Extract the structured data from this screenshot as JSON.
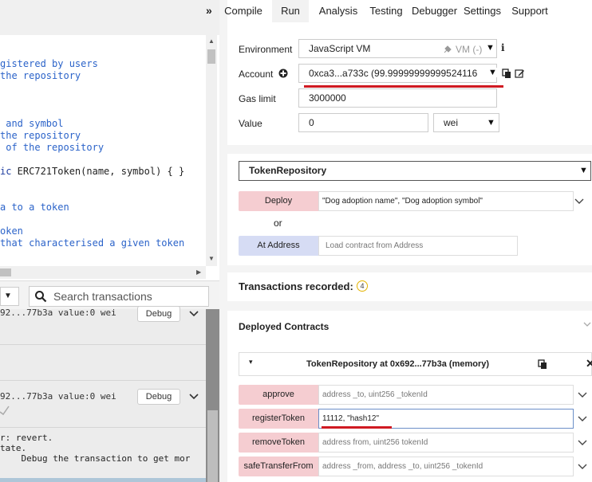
{
  "editor": {
    "lines": [
      {
        "pre": "",
        "text": "gistered by users",
        "cls": "cm"
      },
      {
        "pre": "",
        "text": "the repository",
        "cls": "cm"
      },
      {
        "pre": "",
        "text": "",
        "cls": ""
      },
      {
        "pre": "",
        "text": "",
        "cls": ""
      },
      {
        "pre": "",
        "text": "",
        "cls": ""
      },
      {
        "pre": "",
        "text": " and symbol",
        "cls": "cm"
      },
      {
        "pre": "",
        "text": "the repository",
        "cls": "cm"
      },
      {
        "pre": "",
        "text": " of the repository",
        "cls": "cm"
      },
      {
        "pre": "",
        "text": "",
        "cls": ""
      },
      {
        "pre": "ic",
        "text": " ERC721Token(name, symbol) { }",
        "cls": ""
      },
      {
        "pre": "",
        "text": "",
        "cls": ""
      },
      {
        "pre": "",
        "text": "",
        "cls": ""
      },
      {
        "pre": "",
        "text": "a to a token",
        "cls": "cm"
      },
      {
        "pre": "",
        "text": "",
        "cls": ""
      },
      {
        "pre": "",
        "text": "oken",
        "cls": "cm"
      },
      {
        "pre": "",
        "text": "that characterised a given token",
        "cls": "cm"
      }
    ]
  },
  "terminal": {
    "search_placeholder": "Search transactions",
    "tx1": {
      "text": "92...77b3a value:0 wei",
      "debug_label": "Debug"
    },
    "tx2": {
      "text": "92...77b3a value:0 wei",
      "debug_label": "Debug"
    },
    "error_lines": [
      "r: revert.",
      "tate.",
      "    Debug the transaction to get mor"
    ]
  },
  "tabs": {
    "items": [
      "Compile",
      "Run",
      "Analysis",
      "Testing",
      "Debugger",
      "Settings",
      "Support"
    ],
    "active": "Run"
  },
  "run": {
    "environment_label": "Environment",
    "environment_value": "JavaScript VM",
    "environment_badge": "VM (-)",
    "account_label": "Account",
    "account_value": "0xca3...a733c (99.99999999999524116",
    "gas_limit_label": "Gas limit",
    "gas_limit_value": "3000000",
    "value_label": "Value",
    "value_value": "0",
    "value_unit": "wei"
  },
  "deploy": {
    "contract": "TokenRepository",
    "deploy_label": "Deploy",
    "deploy_args": "\"Dog adoption name\", \"Dog adoption symbol\"",
    "or_label": "or",
    "at_address_label": "At Address",
    "at_address_placeholder": "Load contract from Address"
  },
  "transactions": {
    "label": "Transactions recorded:",
    "count": "4"
  },
  "deployed": {
    "title": "Deployed Contracts",
    "instance_title": "TokenRepository at 0x692...77b3a (memory)",
    "functions": [
      {
        "name": "approve",
        "placeholder": "address _to, uint256 _tokenId",
        "value": ""
      },
      {
        "name": "registerToken",
        "placeholder": "",
        "value": "11112, \"hash12\""
      },
      {
        "name": "removeToken",
        "placeholder": "address from, uint256 tokenId",
        "value": ""
      },
      {
        "name": "safeTransferFrom",
        "placeholder": "address _from, address _to, uint256 _tokenId",
        "value": ""
      }
    ]
  },
  "colors": {
    "accent_red": "#d01a22",
    "transact_fn": "#f5cdd1",
    "call_fn": "#d6dcf4",
    "badge_border": "#e3b300"
  }
}
